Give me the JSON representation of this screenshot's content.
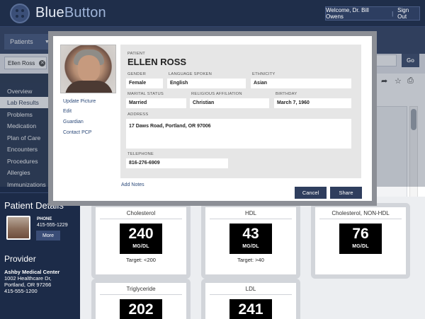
{
  "header": {
    "logo": "BlueButton",
    "welcome": "Welcome, Dr. Bill Owens",
    "signout": "Sign Out"
  },
  "nav": {
    "patients_tab": "Patients",
    "search_chip": "Ellen Ross",
    "go": "Go"
  },
  "sidebar": {
    "items": [
      {
        "label": "Overview",
        "active": false
      },
      {
        "label": "Lab Results",
        "active": true
      },
      {
        "label": "Problems",
        "active": false
      },
      {
        "label": "Medication",
        "active": false
      },
      {
        "label": "Plan of Care",
        "active": false
      },
      {
        "label": "Encounters",
        "active": false
      },
      {
        "label": "Procedures",
        "active": false
      },
      {
        "label": "Allergies",
        "active": false
      },
      {
        "label": "Immunizations",
        "active": false
      }
    ],
    "patient_details_title": "Patient Details",
    "phone_label": "PHONE",
    "phone": "415-555-1229",
    "more": "More",
    "provider_title": "Provider",
    "provider_name": "Ashby Medical Center",
    "provider_lines": [
      "1002 Healthcare Dr,",
      "Portland, OR 97266",
      "415-555-1200"
    ]
  },
  "labs": [
    {
      "name": "Cholesterol",
      "value": "240",
      "unit": "MG/DL",
      "target": "Target: <200"
    },
    {
      "name": "HDL",
      "value": "43",
      "unit": "MG/DL",
      "target": "Target: >40"
    },
    {
      "name": "Cholesterol, NON-HDL",
      "value": "76",
      "unit": "MG/DL",
      "target": ""
    },
    {
      "name": "Triglyceride",
      "value": "202",
      "unit": "",
      "target": ""
    },
    {
      "name": "LDL",
      "value": "241",
      "unit": "",
      "target": ""
    }
  ],
  "modal": {
    "links": [
      "Update Picture",
      "Edit",
      "Guardian",
      "Contact PCP"
    ],
    "patient_label": "PATIENT",
    "patient_name": "ELLEN ROSS",
    "gender_label": "GENDER",
    "gender": "Female",
    "language_label": "LANGUAGE SPOKEN",
    "language": "English",
    "ethnicity_label": "ETHNICITY",
    "ethnicity": "Asian",
    "marital_label": "MARITAL STATUS",
    "marital": "Married",
    "religion_label": "RELIGIOUS AFFILIATION",
    "religion": "Christian",
    "birthday_label": "BIRTHDAY",
    "birthday": "March 7, 1960",
    "address_label": "ADDRESS",
    "address": "17 Daws Road, Portland, OR 97006",
    "telephone_label": "TELEPHONE",
    "telephone": "816-276-6909",
    "add_notes": "Add Notes",
    "cancel": "Cancel",
    "share": "Share"
  }
}
